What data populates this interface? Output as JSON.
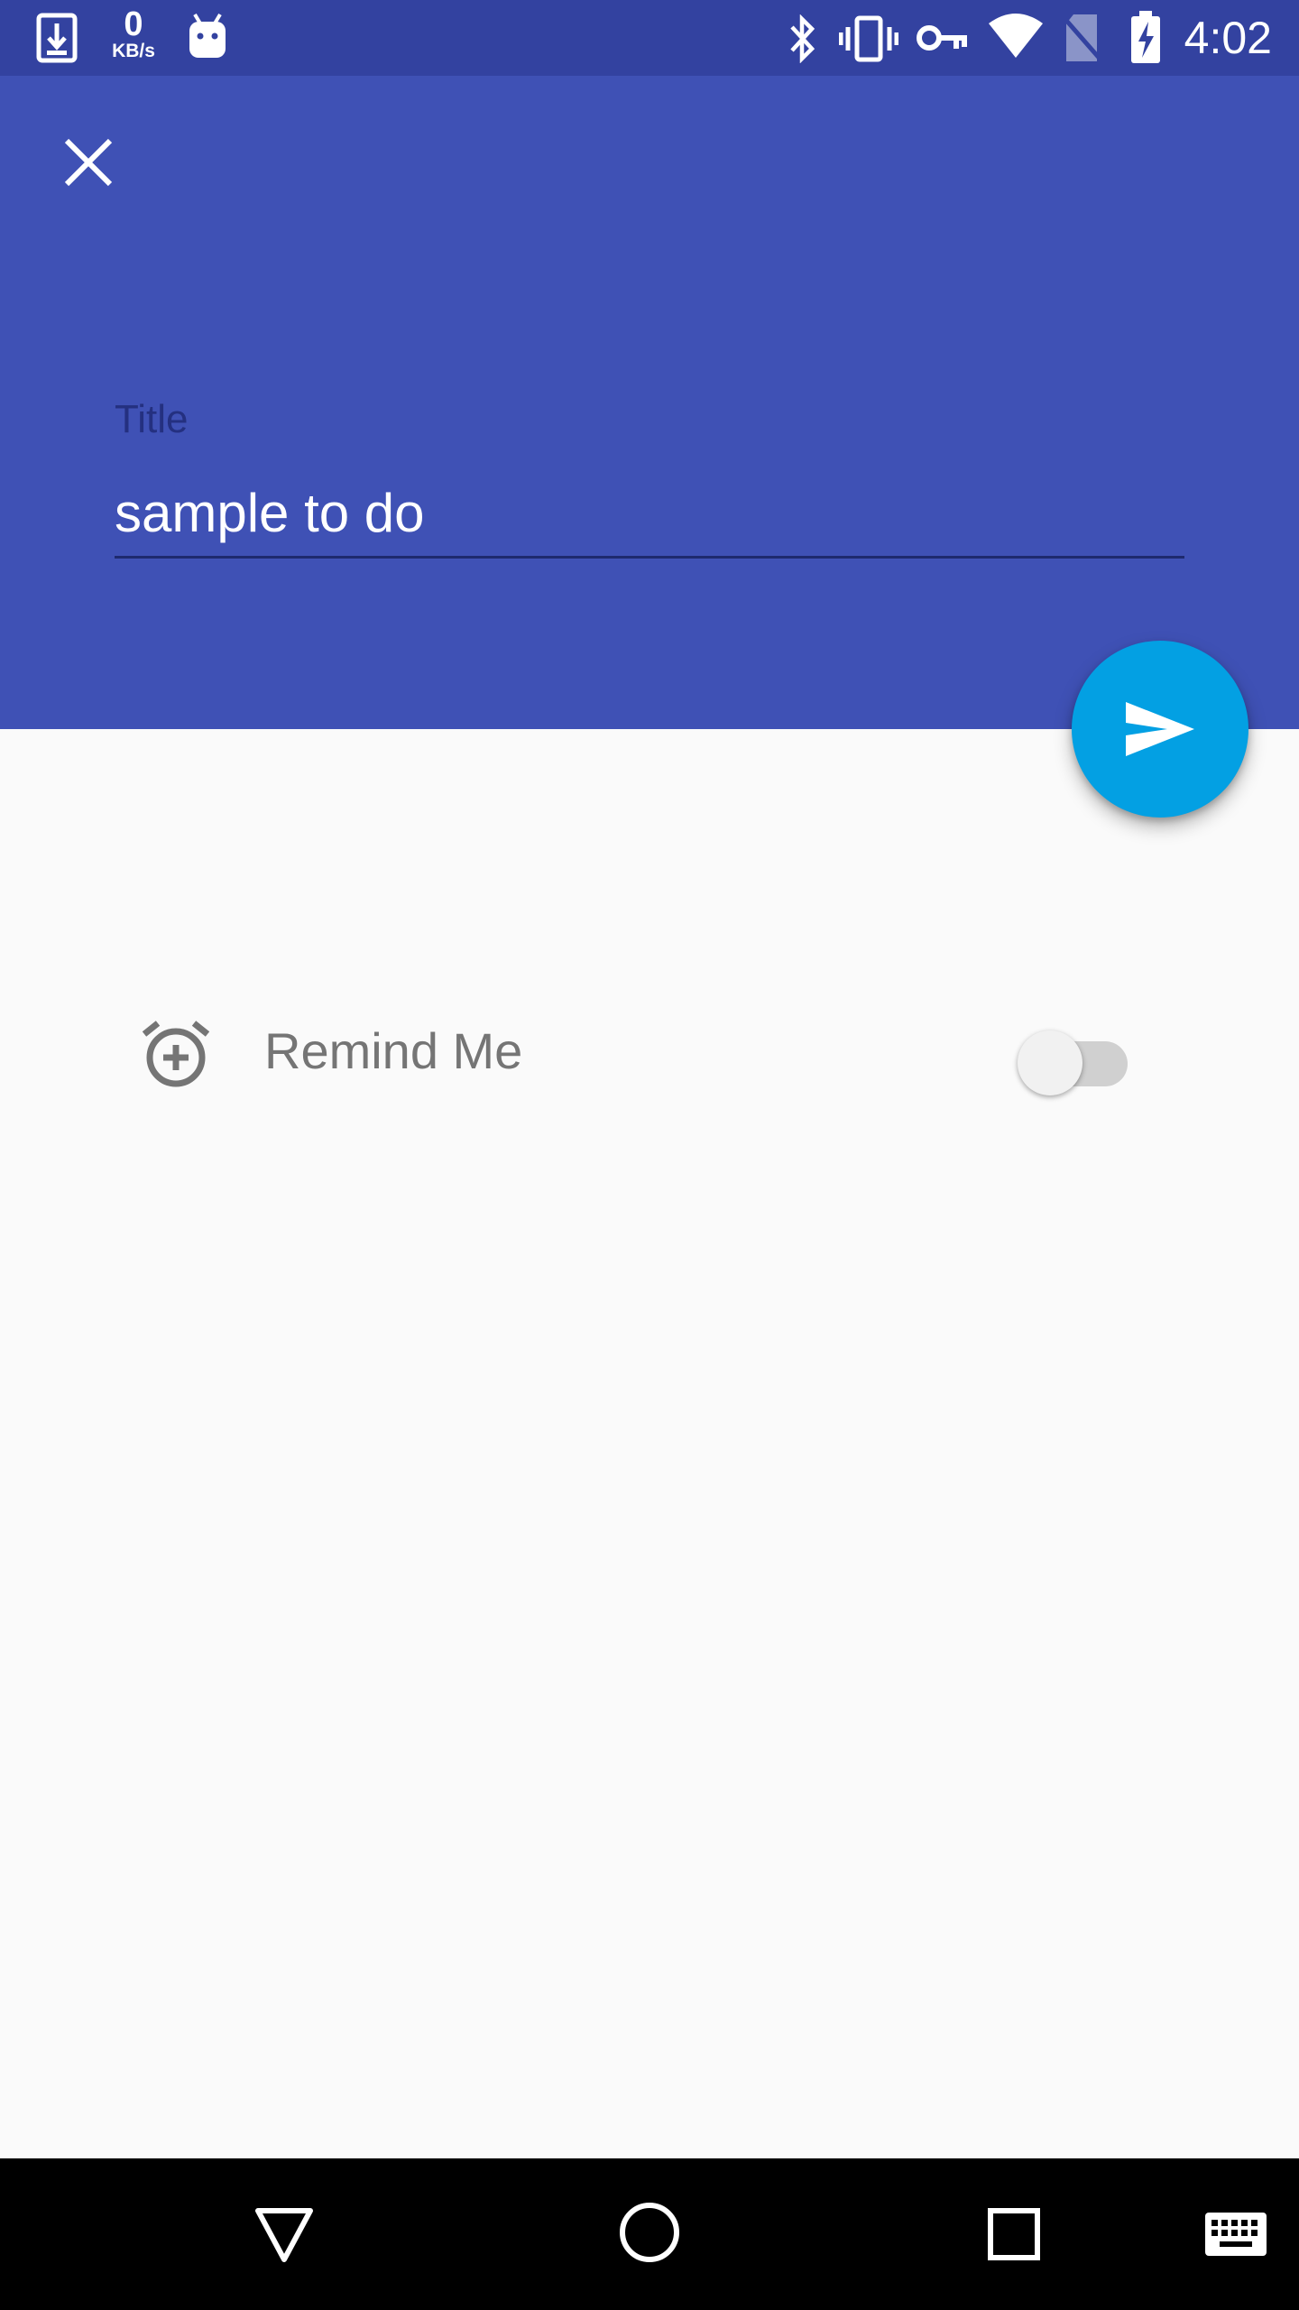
{
  "status_bar": {
    "net_speed_value": "0",
    "net_speed_unit": "KB/s",
    "time": "4:02",
    "icons": [
      "download-icon",
      "android-icon",
      "bluetooth-icon",
      "vibrate-icon",
      "vpn-key-icon",
      "wifi-icon",
      "no-sim-icon",
      "battery-charging-icon"
    ]
  },
  "toolbar": {
    "close_icon": "close-icon"
  },
  "form": {
    "title_label": "Title",
    "title_value": "sample to do"
  },
  "fab": {
    "icon": "send-icon"
  },
  "reminder": {
    "label": "Remind Me",
    "icon": "alarm-add-icon",
    "enabled": false
  },
  "nav_bar": {
    "icons": [
      "back-icon",
      "home-icon",
      "recents-icon",
      "keyboard-icon"
    ]
  },
  "colors": {
    "primary": "#3f51b5",
    "primary_dark": "#3342a0",
    "accent": "#03a0e3",
    "background": "#fafafa"
  }
}
